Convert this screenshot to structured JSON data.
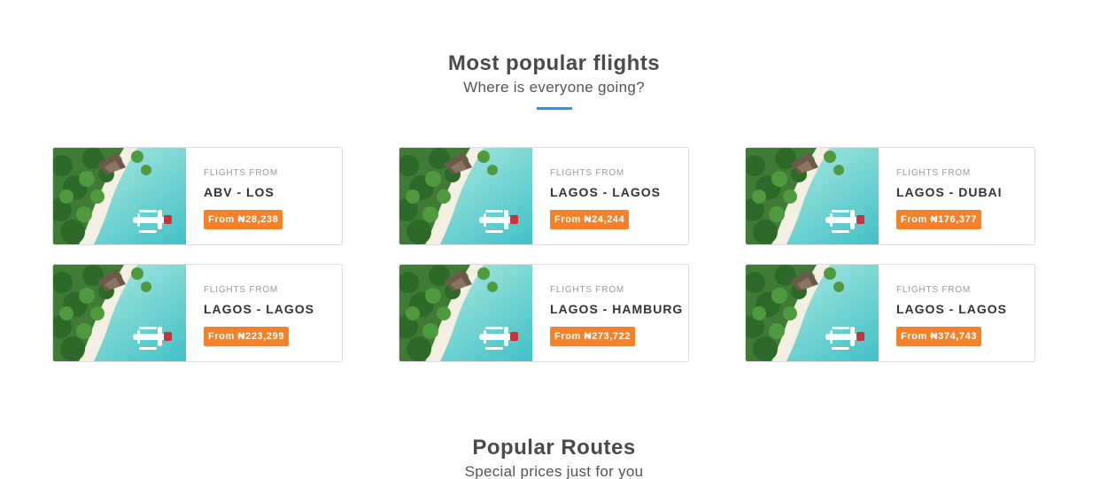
{
  "popular": {
    "title": "Most popular flights",
    "subtitle": "Where is everyone going?"
  },
  "cards": [
    {
      "eyebrow": "FLIGHTS FROM",
      "route": "ABV - LOS",
      "price": "From ₦28,238"
    },
    {
      "eyebrow": "FLIGHTS FROM",
      "route": "LAGOS - LAGOS",
      "price": "From ₦24,244"
    },
    {
      "eyebrow": "FLIGHTS FROM",
      "route": "LAGOS - DUBAI",
      "price": "From ₦176,377"
    },
    {
      "eyebrow": "FLIGHTS FROM",
      "route": "LAGOS - LAGOS",
      "price": "From ₦223,299"
    },
    {
      "eyebrow": "FLIGHTS FROM",
      "route": "LAGOS - HAMBURG",
      "price": "From ₦273,722"
    },
    {
      "eyebrow": "FLIGHTS FROM",
      "route": "LAGOS - LAGOS",
      "price": "From ₦374,743"
    }
  ],
  "routes": {
    "title": "Popular Routes",
    "subtitle": "Special prices just for you"
  },
  "colors": {
    "accent": "#1e9be8",
    "price_badge": "#f5822a"
  }
}
